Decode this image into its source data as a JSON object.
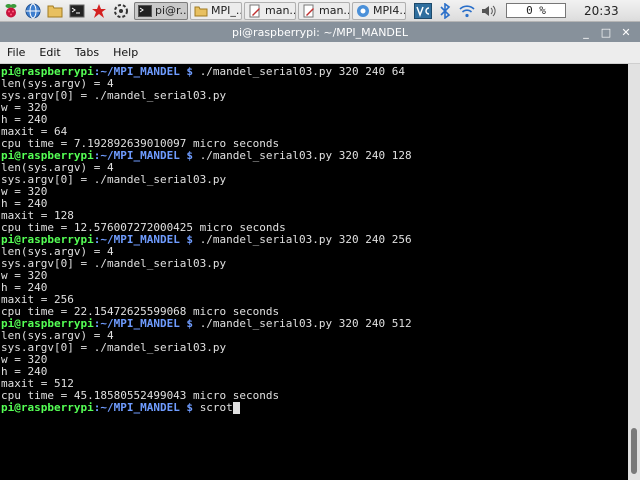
{
  "taskbar": {
    "tasks": [
      {
        "label": "pi@r..."
      },
      {
        "label": "MPI_..."
      },
      {
        "label": "man..."
      },
      {
        "label": "man..."
      },
      {
        "label": "MPI4..."
      }
    ],
    "cpu": "0 %",
    "clock": "20:33"
  },
  "window": {
    "title": "pi@raspberrypi: ~/MPI_MANDEL",
    "minimize": "_",
    "maximize": "□",
    "close": "✕"
  },
  "menu": [
    "File",
    "Edit",
    "Tabs",
    "Help"
  ],
  "terminal": {
    "lines": [
      {
        "user": "pi@raspberrypi",
        "path": ":~/MPI_MANDEL $ ",
        "cmd": "./mandel_serial03.py 320 240 64"
      },
      {
        "text": "len(sys.argv) = 4"
      },
      {
        "text": "sys.argv[0] = ./mandel_serial03.py"
      },
      {
        "text": "w = 320"
      },
      {
        "text": "h = 240"
      },
      {
        "text": "maxit = 64"
      },
      {
        "text": "cpu time = 7.192892639010097 micro seconds"
      },
      {
        "user": "pi@raspberrypi",
        "path": ":~/MPI_MANDEL $ ",
        "cmd": "./mandel_serial03.py 320 240 128"
      },
      {
        "text": "len(sys.argv) = 4"
      },
      {
        "text": "sys.argv[0] = ./mandel_serial03.py"
      },
      {
        "text": "w = 320"
      },
      {
        "text": "h = 240"
      },
      {
        "text": "maxit = 128"
      },
      {
        "text": "cpu time = 12.576007272000425 micro seconds"
      },
      {
        "user": "pi@raspberrypi",
        "path": ":~/MPI_MANDEL $ ",
        "cmd": "./mandel_serial03.py 320 240 256"
      },
      {
        "text": "len(sys.argv) = 4"
      },
      {
        "text": "sys.argv[0] = ./mandel_serial03.py"
      },
      {
        "text": "w = 320"
      },
      {
        "text": "h = 240"
      },
      {
        "text": "maxit = 256"
      },
      {
        "text": "cpu time = 22.15472625599068 micro seconds"
      },
      {
        "user": "pi@raspberrypi",
        "path": ":~/MPI_MANDEL $ ",
        "cmd": "./mandel_serial03.py 320 240 512"
      },
      {
        "text": "len(sys.argv) = 4"
      },
      {
        "text": "sys.argv[0] = ./mandel_serial03.py"
      },
      {
        "text": "w = 320"
      },
      {
        "text": "h = 240"
      },
      {
        "text": "maxit = 512"
      },
      {
        "text": "cpu time = 45.18580552499043 micro seconds"
      }
    ],
    "prompt": {
      "user": "pi@raspberrypi",
      "path": ":~/MPI_MANDEL $ ",
      "cmd": "scrot"
    }
  }
}
